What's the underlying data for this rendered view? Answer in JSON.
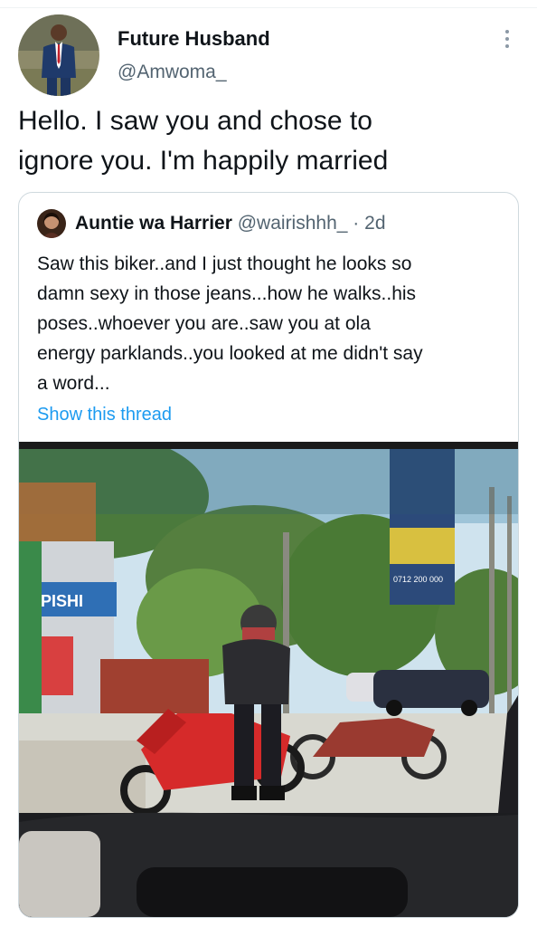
{
  "tweet": {
    "author_name": "Future Husband",
    "author_handle": "@Amwoma_",
    "text_line1": "Hello. I saw you and chose to",
    "text_line2": "ignore you. I'm happily married"
  },
  "quoted_tweet": {
    "author_name": "Auntie wa Harrier",
    "author_handle": "@wairishhh_",
    "separator": "·",
    "time": "2d",
    "lines": [
      "Saw this biker..and I just thought he looks so",
      "damn sexy in those jeans...how he walks..his",
      "poses..whoever you are..saw you at ola",
      "energy parklands..you looked at me didn't say",
      "a word..."
    ],
    "show_thread_label": "Show this thread"
  },
  "photo": {
    "shop_sign": "PISHI",
    "billboard_text": "0712 200 000"
  },
  "icons": {
    "more": "more-vertical-icon"
  },
  "colors": {
    "link": "#1d9bf0",
    "secondary_text": "#536471",
    "border": "#cfd9de"
  }
}
